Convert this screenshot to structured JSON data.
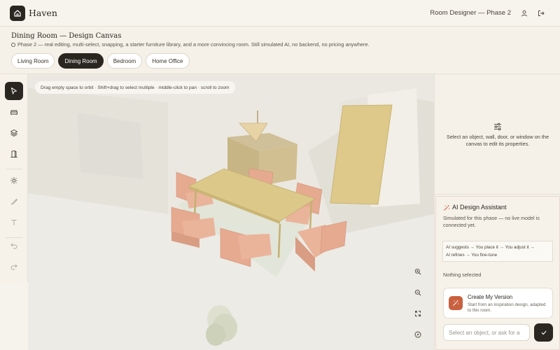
{
  "app": {
    "brand": "Haven",
    "phase_title": "Room Designer — Phase 2",
    "icons": {
      "logo": "home-icon",
      "user": "user-icon",
      "logout": "logout-icon"
    }
  },
  "header": {
    "title": "Dining Room — Design Canvas",
    "subtitle": "Phase 2 — real editing, multi-select, snapping, a starter furniture library, and a more convincing room. Still simulated AI, no backend, no pricing anywhere."
  },
  "tabs": [
    {
      "label": "Living Room",
      "active": false
    },
    {
      "label": "Dining Room",
      "active": true
    },
    {
      "label": "Bedroom",
      "active": false
    },
    {
      "label": "Home Office",
      "active": false
    }
  ],
  "toolbar": {
    "tools": [
      "select-icon",
      "sofa-icon",
      "layers-icon",
      "door-icon",
      "light-icon",
      "paint-icon",
      "text-icon",
      "undo-icon",
      "redo-icon"
    ]
  },
  "canvas": {
    "hint": "Drag empty space to orbit · Shift+drag to select multiple · middle-click to pan · scroll to zoom",
    "controls": [
      "zoom-in-icon",
      "zoom-out-icon",
      "fit-icon",
      "compass-icon"
    ]
  },
  "properties": {
    "empty_text": "Select an object, wall, door, or window on the canvas to edit its properties."
  },
  "ai": {
    "title": "AI Design Assistant",
    "description": "Simulated for this phase — no live model is connected yet.",
    "flow_line1": "AI suggests → You place it → You adjust it →",
    "flow_line2": "AI refines → You fine-tune",
    "nothing_selected": "Nothing selected",
    "create_title": "Create My Version",
    "create_sub": "Start from an inspiration design, adapted to this room.",
    "input_placeholder": "Select an object, or ask for a",
    "input_value": ""
  },
  "colors": {
    "dark": "#2a2620",
    "accent": "#c9603f",
    "furniture": "#e3a58b",
    "table": "#dcc98a",
    "panel": "#f5f1e8"
  }
}
